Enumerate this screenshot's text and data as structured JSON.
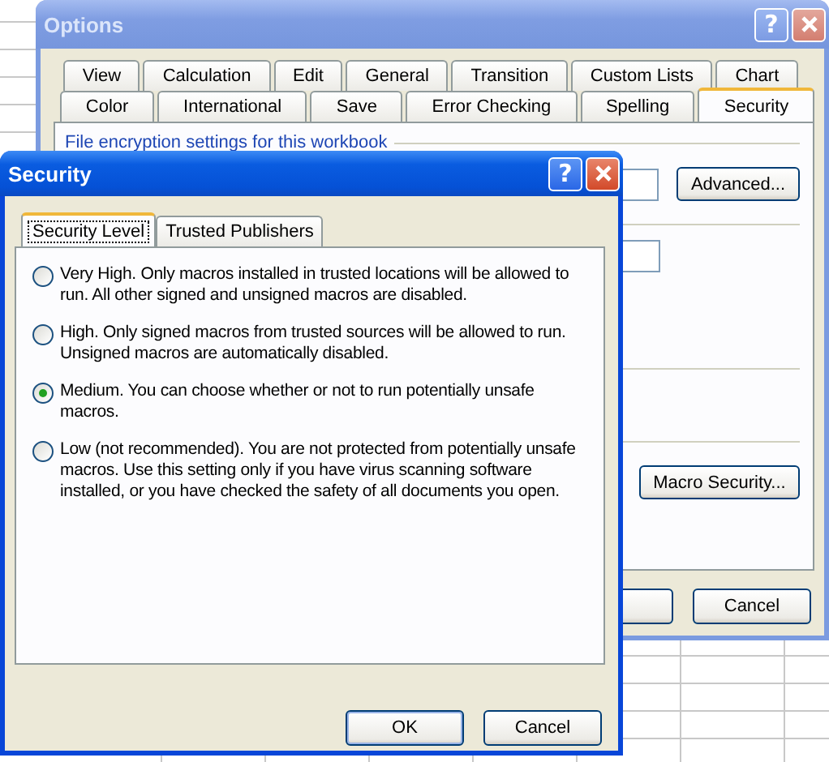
{
  "options_window": {
    "title": "Options",
    "help_button": "?",
    "tabs_row_1": [
      {
        "label": "View",
        "selected": false
      },
      {
        "label": "Calculation",
        "selected": false
      },
      {
        "label": "Edit",
        "selected": false
      },
      {
        "label": "General",
        "selected": false
      },
      {
        "label": "Transition",
        "selected": false
      },
      {
        "label": "Custom Lists",
        "selected": false
      },
      {
        "label": "Chart",
        "selected": false
      }
    ],
    "tabs_row_2": [
      {
        "label": "Color",
        "selected": false
      },
      {
        "label": "International",
        "selected": false
      },
      {
        "label": "Save",
        "selected": false
      },
      {
        "label": "Error Checking",
        "selected": false
      },
      {
        "label": "Spelling",
        "selected": false
      },
      {
        "label": "Security",
        "selected": true
      }
    ],
    "section_heading": "File encryption settings for this workbook",
    "advanced_button": "Advanced...",
    "macro_button": "Macro Security...",
    "cancel_button": "Cancel"
  },
  "security_dialog": {
    "title": "Security",
    "help_button": "?",
    "tabs": [
      {
        "label": "Security Level",
        "selected": true
      },
      {
        "label": "Trusted Publishers",
        "selected": false
      }
    ],
    "options": [
      {
        "text": "Very High. Only macros installed in trusted locations will be allowed to run. All other signed and unsigned macros are disabled.",
        "selected": false
      },
      {
        "text": "High. Only signed macros from trusted sources will be allowed to run. Unsigned macros are automatically disabled.",
        "selected": false
      },
      {
        "text": "Medium. You can choose whether or not to run potentially unsafe macros.",
        "selected": true
      },
      {
        "text": "Low (not recommended). You are not protected from potentially unsafe macros. Use this setting only if you have virus scanning software installed, or you have checked the safety of all documents you open.",
        "selected": false
      }
    ],
    "buttons": [
      "OK",
      "Cancel"
    ]
  }
}
